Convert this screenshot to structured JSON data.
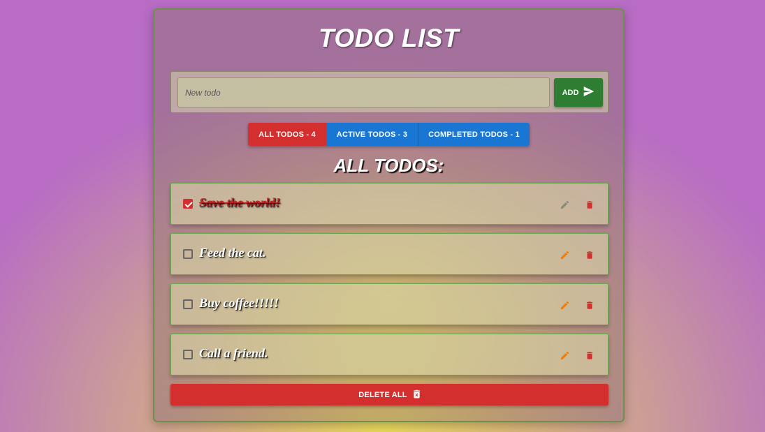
{
  "app": {
    "title": "TODO LIST"
  },
  "new_todo": {
    "placeholder": "New todo",
    "value": "",
    "add_label": "ADD",
    "add_icon": "send-icon"
  },
  "filters": {
    "all": "ALL TODOS - 4",
    "active": "ACTIVE TODOS - 3",
    "completed": "COMPLETED TODOS - 1",
    "selected": "all"
  },
  "section_title": "ALL TODOS:",
  "todos": [
    {
      "text": "Save the world!",
      "completed": true
    },
    {
      "text": "Feed the cat.",
      "completed": false
    },
    {
      "text": "Buy coffee!!!!!",
      "completed": false
    },
    {
      "text": "Call a friend.",
      "completed": false
    }
  ],
  "delete_all": {
    "label": "DELETE ALL",
    "icon": "delete-forever-icon"
  },
  "colors": {
    "danger": "#d32f2f",
    "primary": "#1976d2",
    "success": "#2e7d32",
    "edit_active": "#f57c00",
    "edit_disabled": "#8a8a7a"
  }
}
